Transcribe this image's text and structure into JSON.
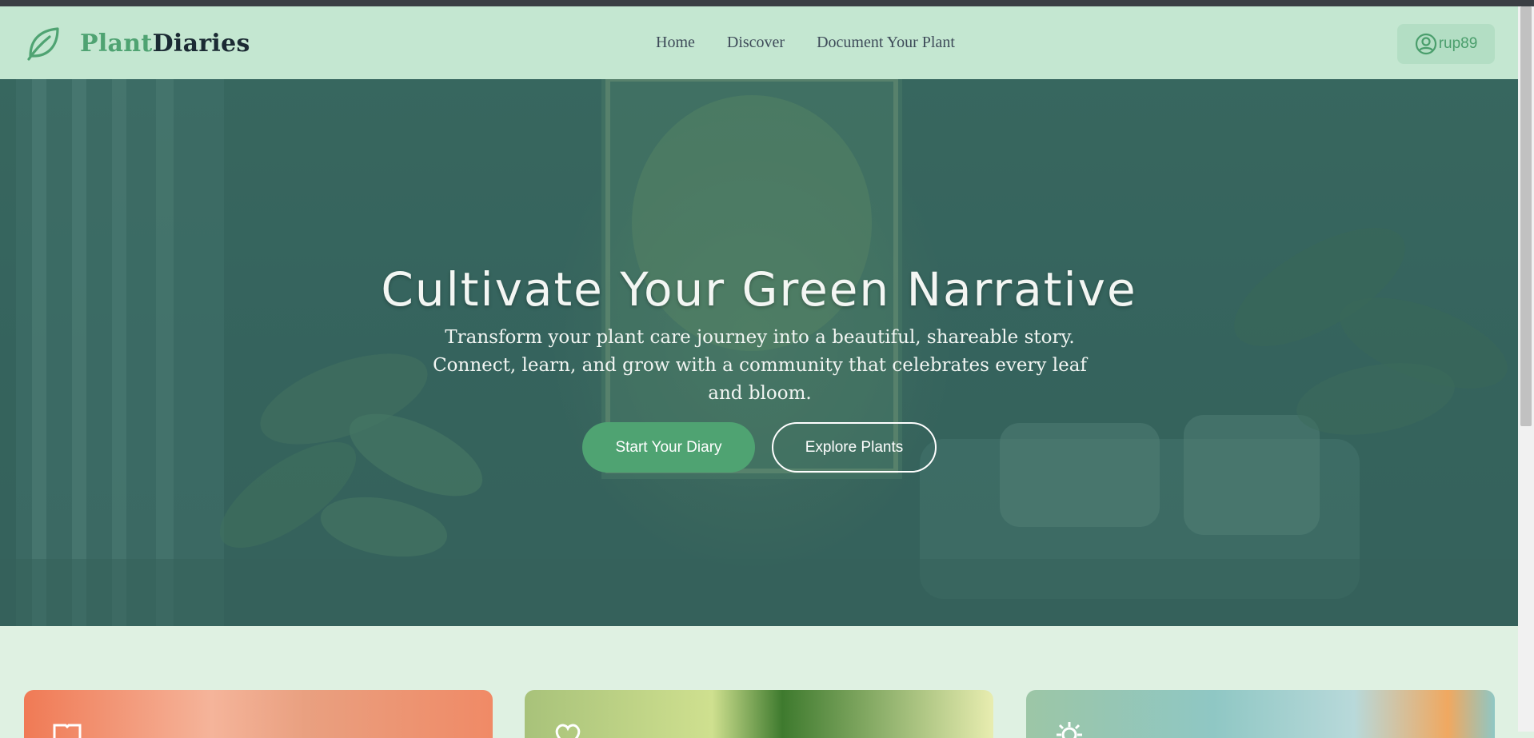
{
  "brand": {
    "name_part1": "Plant",
    "name_part2": "Diaries",
    "logo": "leaf-icon"
  },
  "nav": {
    "items": [
      "Home",
      "Discover",
      "Document Your Plant"
    ]
  },
  "user": {
    "username": "rup89",
    "icon": "user-circle-icon"
  },
  "hero": {
    "title": "Cultivate Your Green Narrative",
    "subtitle": "Transform your plant care journey into a beautiful, shareable story. Connect, learn, and grow with a community that celebrates every leaf and bloom.",
    "primary_button": "Start Your Diary",
    "secondary_button": "Explore Plants"
  },
  "cards": [
    {
      "icon": "book-icon",
      "accent": "#f07a55"
    },
    {
      "icon": "heart-icon",
      "accent": "#a8c27a"
    },
    {
      "icon": "gear-icon",
      "accent": "#8fc7c4"
    }
  ],
  "colors": {
    "brand_green": "#4fa372",
    "navbar_bg": "#c4e7d1",
    "hero_overlay": "#2f625a",
    "page_bg": "#dff1e2"
  }
}
